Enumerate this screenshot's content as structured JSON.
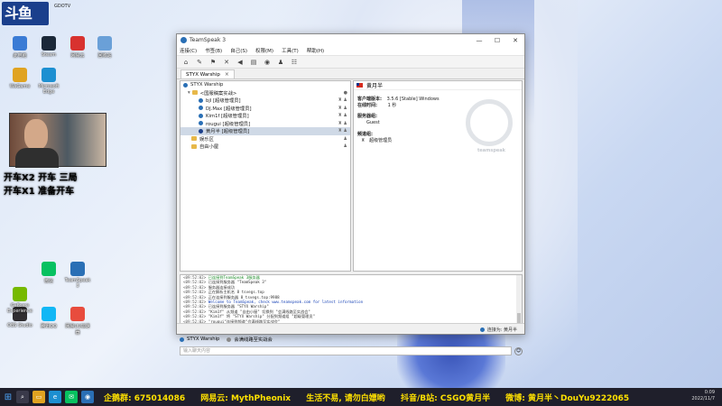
{
  "desktop": {
    "logo_text": "斗鱼",
    "logo_sub": "GDOTV",
    "icons": [
      {
        "label": "此电脑",
        "color": "#3a7bd5"
      },
      {
        "label": "Steam",
        "color": "#1b2838"
      },
      {
        "label": "网易云",
        "color": "#d8322f"
      },
      {
        "label": "回收站",
        "color": "#6aa0d8"
      },
      {
        "label": "WeGame",
        "color": "#e0a321"
      },
      {
        "label": "Microsoft Edge",
        "color": "#1d8fd1"
      },
      {
        "label": "OBS Studio",
        "color": "#302e31"
      },
      {
        "label": "腾讯QQ",
        "color": "#12b7f5"
      },
      {
        "label": "网易UU加速器",
        "color": "#e84c3d"
      },
      {
        "label": "GeForce Experience",
        "color": "#76b900"
      },
      {
        "label": "TeamSpeak 3",
        "color": "#2a6fb5"
      },
      {
        "label": "微信",
        "color": "#07c160"
      }
    ],
    "overlay_lines": [
      {
        "text": "开车X2 开车 三局",
        "color": "#ffe100"
      },
      {
        "text": "开车X1 准备开车",
        "color": "#00e05a"
      }
    ]
  },
  "window": {
    "title": "TeamSpeak 3",
    "controls": {
      "minimize": "—",
      "maximize": "☐",
      "close": "✕"
    },
    "menu": [
      "连接(C)",
      "书签(B)",
      "自己(S)",
      "权限(M)",
      "工具(T)",
      "帮助(H)"
    ],
    "tab": "STYX Warship",
    "tree": {
      "server": "STYX Warship",
      "channel": "<国服稿案实战>",
      "users": [
        {
          "name": "bjl [超级管理员]",
          "color": "#2a6fb5"
        },
        {
          "name": "DJ.Max [超级管理员]",
          "color": "#2a6fb5"
        },
        {
          "name": "Kim1f [超级管理员]",
          "color": "#2a6fb5"
        },
        {
          "name": "rougui [超级管理员]",
          "color": "#2a6fb5"
        },
        {
          "name": "黄月半 [超级管理员]",
          "color": "#1c3f8a"
        }
      ],
      "channels": [
        "娱乐区",
        "自由小屋"
      ]
    },
    "info": {
      "nickname": "黄月半",
      "client_version_label": "客户端版本:",
      "client_version": "3.5.6 [Stable] Windows",
      "online_label": "在线时间:",
      "online": "1 秒",
      "server_groups_label": "服务器组:",
      "server_group": "Guest",
      "channel_group_label": "频道组:",
      "channel_group": "超级管理员",
      "watermark": "teamspeak"
    },
    "log": [
      {
        "time": "<09:52:02>",
        "text": "已连接到TeamSpeak 3服务器",
        "class": "green"
      },
      {
        "time": "<09:52:02>",
        "text": "已连接到服务器 \"TeamSpeak 3\"",
        "class": ""
      },
      {
        "time": "<09:52:02>",
        "text": "服务器连接成功",
        "class": ""
      },
      {
        "time": "<09:52:02>",
        "text": "正在解析主机名 8 tsvegs.top",
        "class": ""
      },
      {
        "time": "<09:52:02>",
        "text": "正在连接到服务器 8 tsvegs.top:9988",
        "class": ""
      },
      {
        "time": "<09:52:02>",
        "text": "Welcome to TeamSpeak, check www.teamspeak.com for latest information",
        "class": "blue"
      },
      {
        "time": "<09:52:02>",
        "text": "已连接到服务器 \"STYX Warship\"",
        "class": ""
      },
      {
        "time": "<09:52:02>",
        "text": "\"Kim1f\" 从频道 \"自由小屋\" 切换到 \"会满线路至实战会\"",
        "class": ""
      },
      {
        "time": "<09:52:02>",
        "text": "\"Kim1f\" 将 \"STYX Warship\" 分配到频道组 \"超级管理员\"",
        "class": ""
      },
      {
        "time": "<09:52:02>",
        "text": "\"rougui\"连接到频道\"会满线路至实战会\"",
        "class": ""
      },
      {
        "time": "<09:54:22>",
        "text": "\"DJ.Max\"连接到频道\"会满线路至实战会\"",
        "class": ""
      }
    ],
    "bottom_tabs": [
      "STYX Warship",
      "会满线路至实战会"
    ],
    "chat_placeholder": "输入聊天内容",
    "status_text": "连接为: 黄月半"
  },
  "taskbar": {
    "ticker": [
      {
        "text": "企鹅群: 675014086",
        "color": "#ffe100"
      },
      {
        "text": "网易云: MythPheonix",
        "color": "#ffe100"
      },
      {
        "text": "生活不易, 请勿白嫖哟",
        "color": "#ffe100"
      },
      {
        "text": "抖音/B站: CSGO黄月半",
        "color": "#ffe100"
      },
      {
        "text": "微博: 黄月半丶DouYu9222065",
        "color": "#ffe100"
      }
    ],
    "time": "0:09",
    "date": "2022/11/7"
  }
}
